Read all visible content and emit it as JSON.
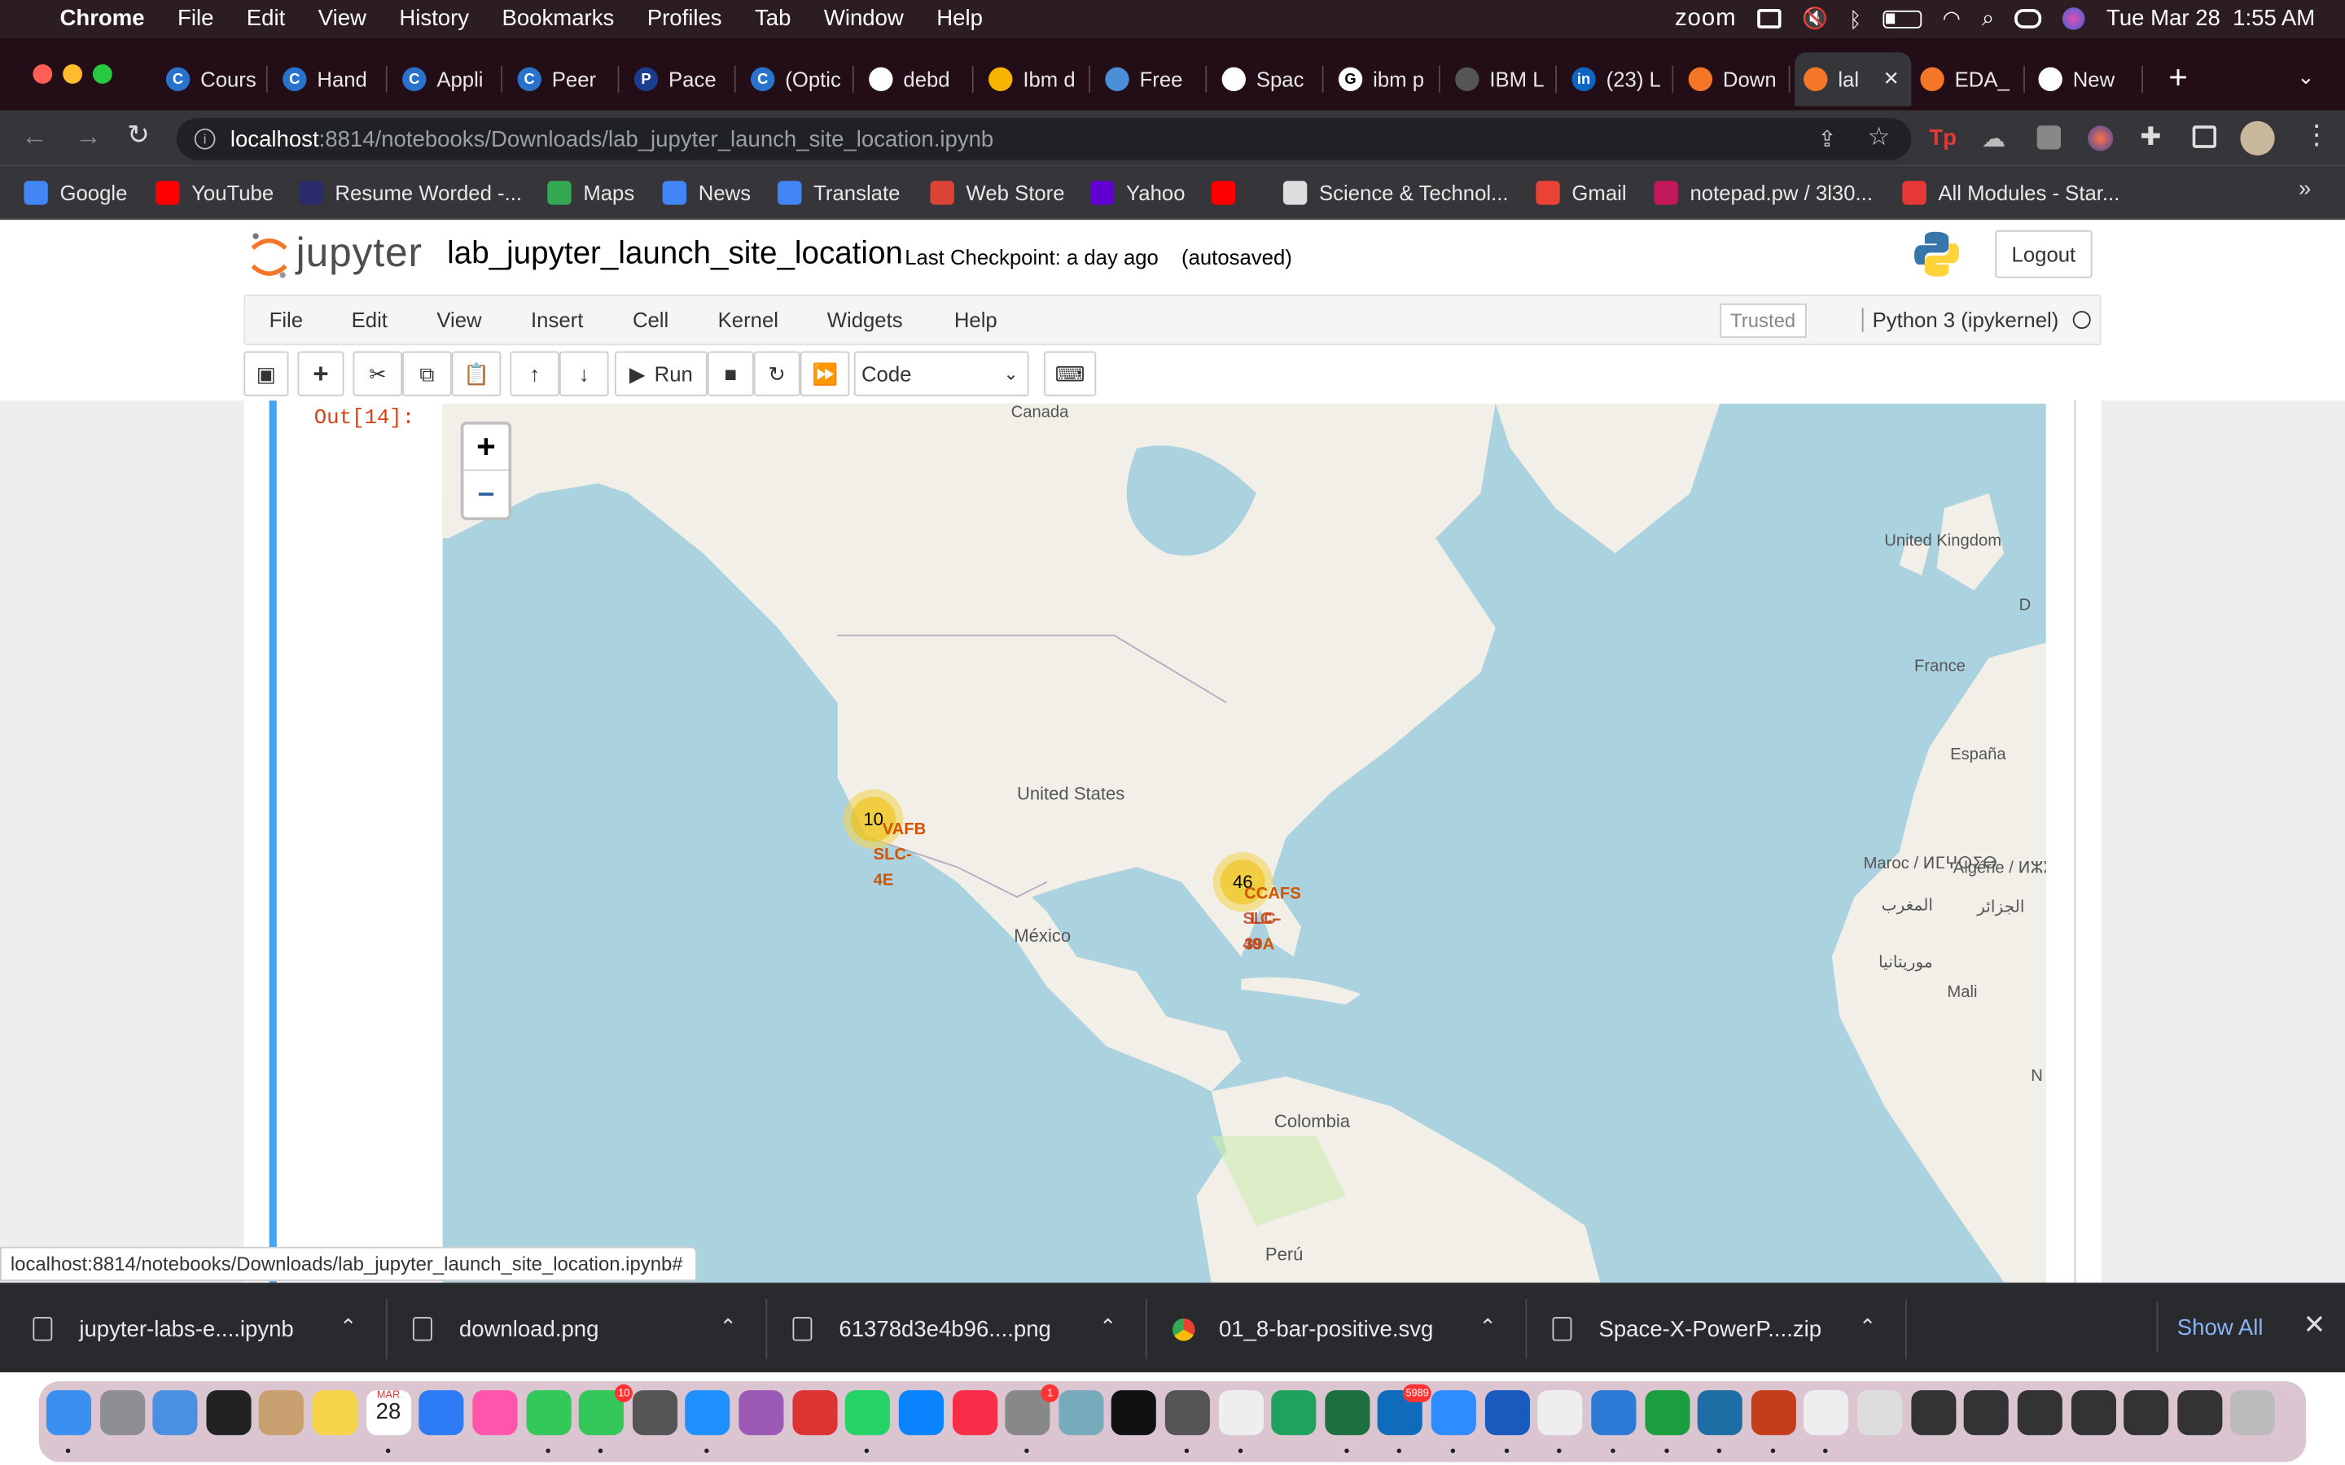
{
  "menubar": {
    "app": "Chrome",
    "items": [
      "File",
      "Edit",
      "View",
      "History",
      "Bookmarks",
      "Profiles",
      "Tab",
      "Window",
      "Help"
    ],
    "zoom_label": "zoom",
    "datetime": "Tue Mar 28  1:55 AM"
  },
  "tabs": [
    {
      "label": "Cours",
      "icon": "coursera-icon",
      "color": "#2a73cc",
      "glyph": "C"
    },
    {
      "label": "Hand",
      "icon": "coursera-icon",
      "color": "#2a73cc",
      "glyph": "C"
    },
    {
      "label": "Appli",
      "icon": "coursera-icon",
      "color": "#2a73cc",
      "glyph": "C"
    },
    {
      "label": "Peer",
      "icon": "coursera-icon",
      "color": "#2a73cc",
      "glyph": "C"
    },
    {
      "label": "Pace",
      "icon": "pace-icon",
      "color": "#1a3d8f",
      "glyph": "P"
    },
    {
      "label": "(Optic",
      "icon": "coursera-icon",
      "color": "#2a73cc",
      "glyph": "C"
    },
    {
      "label": "debd",
      "icon": "github-icon",
      "color": "#ffffff",
      "glyph": ""
    },
    {
      "label": "Ibm d",
      "icon": "slides-icon",
      "color": "#f4b400",
      "glyph": ""
    },
    {
      "label": "Free",
      "icon": "tab-icon",
      "color": "#4a90d9",
      "glyph": ""
    },
    {
      "label": "Spac",
      "icon": "github-icon",
      "color": "#ffffff",
      "glyph": ""
    },
    {
      "label": "ibm p",
      "icon": "google-icon",
      "color": "#ffffff",
      "glyph": "G"
    },
    {
      "label": "IBM L",
      "icon": "tab-icon",
      "color": "#555555",
      "glyph": ""
    },
    {
      "label": "(23) L",
      "icon": "linkedin-icon",
      "color": "#0a66c2",
      "glyph": "in"
    },
    {
      "label": "Down",
      "icon": "jupyter-icon",
      "color": "#f37726",
      "glyph": ""
    },
    {
      "label": "lal",
      "icon": "notebook-icon",
      "color": "#f37726",
      "glyph": "",
      "active": true
    },
    {
      "label": "EDA_",
      "icon": "notebook-icon",
      "color": "#f37726",
      "glyph": ""
    },
    {
      "label": "New",
      "icon": "chrome-icon",
      "color": "#ffffff",
      "glyph": ""
    }
  ],
  "address": {
    "host": "localhost",
    "rest": ":8814/notebooks/Downloads/lab_jupyter_launch_site_location.ipynb"
  },
  "bookmarks": [
    {
      "label": "Google",
      "color": "#4285f4"
    },
    {
      "label": "YouTube",
      "color": "#ff0000"
    },
    {
      "label": "Resume Worded -...",
      "color": "#2b2b6b"
    },
    {
      "label": "Maps",
      "color": "#34a853"
    },
    {
      "label": "News",
      "color": "#4285f4"
    },
    {
      "label": "Translate",
      "color": "#4285f4"
    },
    {
      "label": "Web Store",
      "color": "#db4437"
    },
    {
      "label": "Yahoo",
      "color": "#6001d2"
    },
    {
      "label": "",
      "color": "#ff0000"
    },
    {
      "label": "Science & Technol...",
      "color": "#dddddd"
    },
    {
      "label": "Gmail",
      "color": "#ea4335"
    },
    {
      "label": "notepad.pw / 3l30...",
      "color": "#c2185b"
    },
    {
      "label": "All Modules - Star...",
      "color": "#e53935"
    }
  ],
  "jupyter": {
    "logo": "jupyter",
    "title": "lab_jupyter_launch_site_location",
    "checkpoint": "Last Checkpoint: a day ago",
    "autosaved": "(autosaved)",
    "logout": "Logout",
    "menu": [
      "File",
      "Edit",
      "View",
      "Insert",
      "Cell",
      "Kernel",
      "Widgets",
      "Help"
    ],
    "trusted": "Trusted",
    "kernel": "Python 3 (ipykernel)",
    "run": "Run",
    "cell_type": "Code",
    "prompt": "Out[14]:"
  },
  "map": {
    "zoom_in": "+",
    "zoom_out": "–",
    "labels": [
      "Canada",
      "United Kingdom",
      "D",
      "France",
      "España",
      "Maroc / ⵍⵎⵖⵔⵉⴱ",
      "المغرب",
      "Algérie / ⵍⵣⵣⴰⵢⴻⵔ /",
      "الجزائر",
      "موريتانيا",
      "Mali",
      "N",
      "United States",
      "México",
      "Colombia",
      "Perú"
    ],
    "clusters": [
      {
        "count": "10",
        "sites": [
          "VAFB",
          "SLC-",
          "4E"
        ]
      },
      {
        "count": "46",
        "sites": [
          "CCAFS",
          "LC-",
          "39A",
          "SLC-",
          "40"
        ]
      }
    ]
  },
  "status_url": "localhost:8814/notebooks/Downloads/lab_jupyter_launch_site_location.ipynb#",
  "downloads": [
    {
      "name": "jupyter-labs-e....ipynb",
      "icon": "file-icon"
    },
    {
      "name": "download.png",
      "icon": "file-icon"
    },
    {
      "name": "61378d3e4b96....png",
      "icon": "file-icon"
    },
    {
      "name": "01_8-bar-positive.svg",
      "icon": "chrome-file-icon"
    },
    {
      "name": "Space-X-PowerP....zip",
      "icon": "file-icon"
    }
  ],
  "show_all": "Show All",
  "dock": {
    "calendar_month": "MAR",
    "calendar_day": "28",
    "messages_badge": "10",
    "settings_badge": "1",
    "outlook_badge": "5989"
  }
}
